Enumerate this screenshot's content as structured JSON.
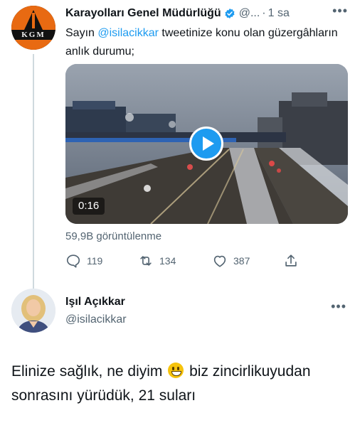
{
  "tweet1": {
    "author_name": "Karayolları Genel Müdürlüğü",
    "handle": "@...",
    "separator": "·",
    "time": "1 sa",
    "avatar_text": "KGM",
    "text_prefix": "Sayın ",
    "mention": "@isilacikkar",
    "text_suffix": " tweetinize konu olan güzergâhların anlık durumu;",
    "video_duration": "0:16",
    "views": "59,9B görüntülenme",
    "replies": "119",
    "retweets": "134",
    "likes": "387",
    "more": "•••"
  },
  "tweet2": {
    "author_name": "Işıl Açıkkar",
    "handle": "@isilacikkar",
    "more": "•••",
    "text_part1": "Elinize sağlık, ne diyim ",
    "text_part2": " biz zincirlikuyudan sonrasını yürüdük, 21 suları"
  },
  "colors": {
    "accent": "#1d9bf0",
    "muted": "#536471",
    "text": "#0f1419",
    "line": "#cfd9de",
    "kgm_orange": "#e86a12"
  },
  "icons": {
    "reply": "reply-icon",
    "retweet": "retweet-icon",
    "like": "heart-icon",
    "share": "share-icon",
    "verified": "verified-badge-icon",
    "play": "play-icon",
    "emoji": "grinning-face-emoji"
  }
}
